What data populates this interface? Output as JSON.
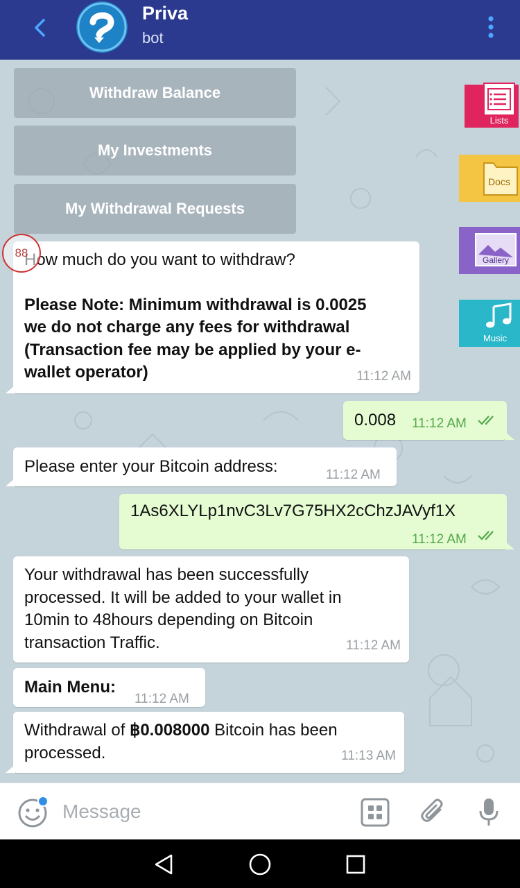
{
  "header": {
    "title": "Priva",
    "subtitle": "bot"
  },
  "keyboard_buttons": [
    "Withdraw Balance",
    "My Investments",
    "My Withdrawal Requests"
  ],
  "side_icons": [
    {
      "label": "Lists",
      "color": "#e0245e"
    },
    {
      "label": "Docs",
      "color": "#f4c542"
    },
    {
      "label": "Gallery",
      "color": "#8a63c9"
    },
    {
      "label": "Music",
      "color": "#2ab7c9"
    }
  ],
  "counter": "88",
  "messages": [
    {
      "lines": [
        "How much do you want to withdraw?",
        "",
        "Please Note: Minimum withdrawal is 0.0025",
        "we do not charge any fees for withdrawal",
        "(Transaction fee may be applied by your e-",
        "wallet operator)"
      ],
      "time": "11:12 AM"
    },
    {
      "text": "0.008",
      "time": "11:12 AM"
    },
    {
      "text": "Please enter your Bitcoin address:",
      "time": "11:12 AM"
    },
    {
      "text": "1As6XLYLp1nvC3Lv7G75HX2cChzJAVyf1X",
      "time": "11:12 AM"
    },
    {
      "lines": [
        "Your withdrawal has been successfully",
        "processed. It will be added to your wallet in",
        "10min to 48hours depending on Bitcoin",
        "transaction Traffic."
      ],
      "time": "11:12 AM"
    },
    {
      "text": "Main Menu:",
      "time": "11:12 AM"
    },
    {
      "prefix": "Withdrawal of ",
      "amount": "฿0.008000",
      "suffix": " Bitcoin has been",
      "line2": "processed.",
      "time": "11:13 AM"
    }
  ],
  "input": {
    "placeholder": "Message"
  },
  "colors": {
    "header": "#2b3a8f",
    "chat_bg": "#c5d3da",
    "incoming": "#ffffff",
    "outgoing": "#e5fcd3",
    "outgoing_time": "#53a84a"
  }
}
